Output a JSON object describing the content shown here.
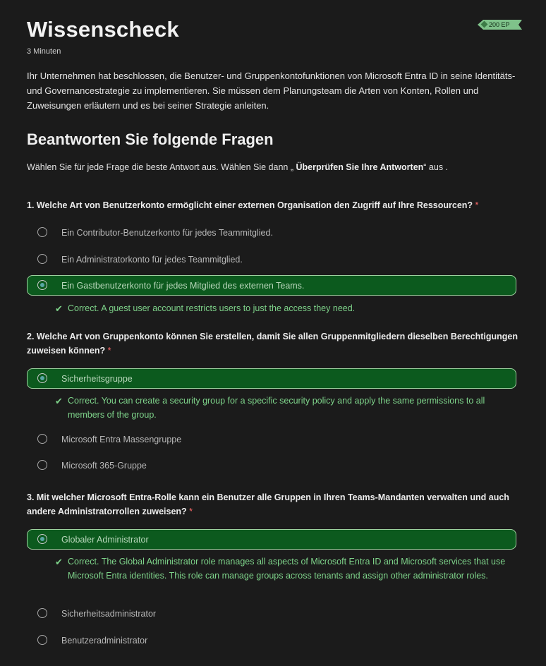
{
  "header": {
    "title": "Wissenscheck",
    "duration": "3 Minuten",
    "xp": "200 EP"
  },
  "intro": "Ihr Unternehmen hat beschlossen, die Benutzer- und Gruppenkontofunktionen von Microsoft Entra ID in seine Identitäts- und Governancestrategie zu implementieren. Sie müssen dem Planungsteam die Arten von Konten, Rollen und Zuweisungen erläutern und es bei seiner Strategie anleiten.",
  "section": {
    "title": "Beantworten Sie folgende Fragen",
    "instruction_pre": "Wählen Sie für jede Frage die beste Antwort aus. Wählen Sie dann „",
    "instruction_bold": " Überprüfen Sie Ihre Antworten",
    "instruction_post": "“ aus ."
  },
  "required_marker": "*",
  "check_glyph": "✔",
  "questions": [
    {
      "text": "1. Welche Art von Benutzerkonto ermöglicht einer externen Organisation den Zugriff auf Ihre Ressourcen?",
      "options": [
        {
          "label": "Ein Contributor-Benutzerkonto für jedes Teammitglied.",
          "selected": false
        },
        {
          "label": "Ein Administratorkonto für jedes Teammitglied.",
          "selected": false
        },
        {
          "label": "Ein Gastbenutzerkonto für jedes Mitglied des externen Teams.",
          "selected": true
        }
      ],
      "feedback": "Correct. A guest user account restricts users to just the access they need."
    },
    {
      "text": "2. Welche Art von Gruppenkonto können Sie erstellen, damit Sie allen Gruppenmitgliedern dieselben Berechtigungen zuweisen können?",
      "options": [
        {
          "label": "Sicherheitsgruppe",
          "selected": true
        },
        {
          "label": "Microsoft Entra Massengruppe",
          "selected": false
        },
        {
          "label": "Microsoft 365-Gruppe",
          "selected": false
        }
      ],
      "feedback": "Correct. You can create a security group for a specific security policy and apply the same permissions to all members of the group."
    },
    {
      "text": "3. Mit welcher Microsoft Entra-Rolle kann ein Benutzer alle Gruppen in Ihren Teams-Mandanten verwalten und auch andere Administratorrollen zuweisen?",
      "options": [
        {
          "label": "Globaler Administrator",
          "selected": true
        },
        {
          "label": "Sicherheitsadministrator",
          "selected": false
        },
        {
          "label": "Benutzeradministrator",
          "selected": false
        }
      ],
      "feedback": "Correct. The Global Administrator role manages all aspects of Microsoft Entra ID and Microsoft services that use Microsoft Entra identities. This role can manage groups across tenants and assign other administrator roles."
    }
  ]
}
